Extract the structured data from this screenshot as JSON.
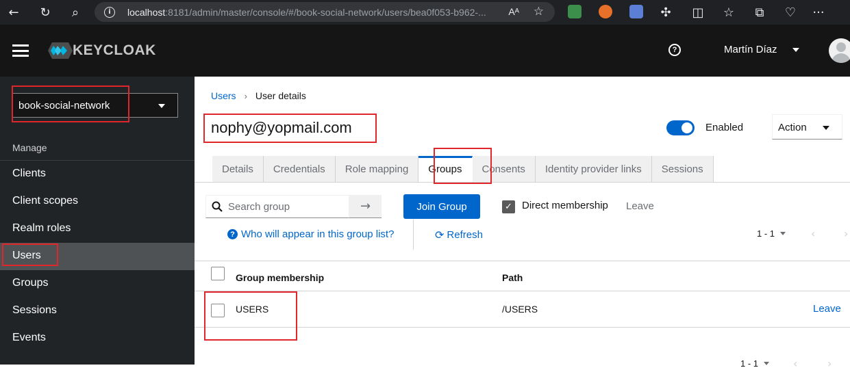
{
  "browser": {
    "url_host": "localhost",
    "url_rest": ":8181/admin/master/console/#/book-social-network/users/bea0f053-b962-...",
    "reader_label": "Aᴬ"
  },
  "header": {
    "logo_text": "KEYCLOAK",
    "user_name": "Martín Díaz"
  },
  "sidebar": {
    "realm": "book-social-network",
    "section": "Manage",
    "items": [
      {
        "label": "Clients"
      },
      {
        "label": "Client scopes"
      },
      {
        "label": "Realm roles"
      },
      {
        "label": "Users"
      },
      {
        "label": "Groups"
      },
      {
        "label": "Sessions"
      },
      {
        "label": "Events"
      }
    ],
    "active_item": "Users"
  },
  "breadcrumb": {
    "parent": "Users",
    "current": "User details"
  },
  "page": {
    "title": "nophy@yopmail.com",
    "enabled_label": "Enabled",
    "enabled": true,
    "action_label": "Action"
  },
  "tabs": [
    {
      "label": "Details"
    },
    {
      "label": "Credentials"
    },
    {
      "label": "Role mapping"
    },
    {
      "label": "Groups"
    },
    {
      "label": "Consents"
    },
    {
      "label": "Identity provider links"
    },
    {
      "label": "Sessions"
    }
  ],
  "active_tab": "Groups",
  "toolbar": {
    "search_placeholder": "Search group",
    "join_label": "Join Group",
    "direct_label": "Direct membership",
    "direct_checked": true,
    "leave_label": "Leave",
    "who_label": "Who will appear in this group list?",
    "refresh_label": "Refresh",
    "pagination": "1 - 1"
  },
  "table": {
    "columns": [
      "Group membership",
      "Path"
    ],
    "rows": [
      {
        "group": "USERS",
        "path": "/USERS",
        "action": "Leave"
      }
    ]
  },
  "bottom_pagination": "1 - 1",
  "colors": {
    "accent": "#0066cc",
    "header_bg": "#151515",
    "sidebar_bg": "#212427",
    "annotation": "#e0252b"
  }
}
